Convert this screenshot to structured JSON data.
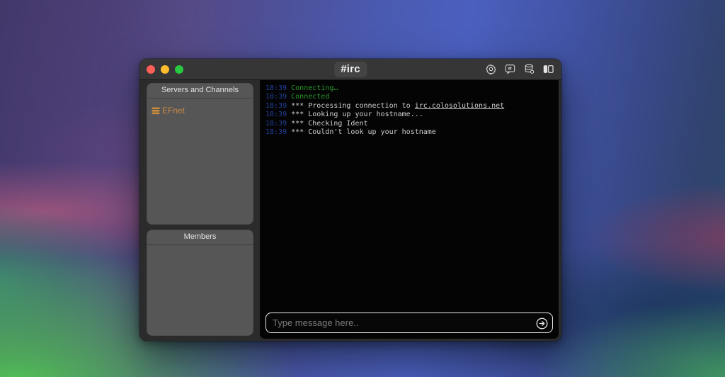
{
  "window": {
    "title": "#irc",
    "traffic_lights": {
      "close": "#ff5f57",
      "minimize": "#febc2e",
      "zoom": "#28c840"
    },
    "toolbar_icons": [
      "settings-gear",
      "channel-hash-bubble",
      "server-database",
      "sidebar-layout-toggle"
    ]
  },
  "sidebar": {
    "servers_header": "Servers and Channels",
    "members_header": "Members",
    "servers": [
      {
        "label": "EFnet",
        "icon": "server-stack",
        "icon_color": "#c98a3e"
      }
    ],
    "members": []
  },
  "chat": {
    "colors": {
      "timestamp": "#22409e",
      "green": "#2c9a2e",
      "system": "#cfcfcf",
      "background": "#040404"
    },
    "lines": [
      {
        "time": "18:39",
        "text": "Connecting…",
        "type": "status-green"
      },
      {
        "time": "18:39",
        "text": "Connected",
        "type": "status-green"
      },
      {
        "time": "18:39",
        "text": "*** Processing connection to ",
        "link": "irc.colosolutions.net",
        "type": "system"
      },
      {
        "time": "18:39",
        "text": "*** Looking up your hostname...",
        "type": "system"
      },
      {
        "time": "18:39",
        "text": "*** Checking Ident",
        "type": "system"
      },
      {
        "time": "18:39",
        "text": "*** Couldn't look up your hostname",
        "type": "system"
      }
    ]
  },
  "composer": {
    "placeholder": "Type message here.."
  }
}
